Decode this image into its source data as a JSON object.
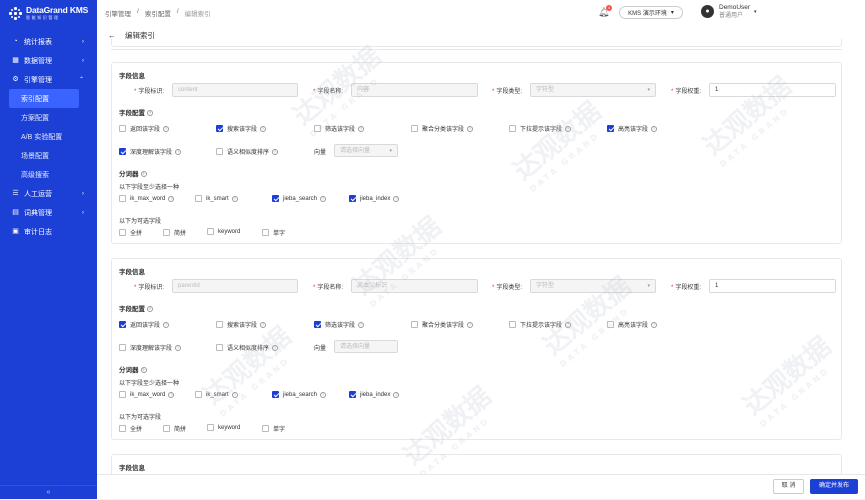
{
  "app": {
    "title": "DataGrand KMS",
    "subtitle": "智能知识管理"
  },
  "sidebar": {
    "items": [
      {
        "label": "统计报表",
        "icon": "chart-icon",
        "arrow": "›"
      },
      {
        "label": "数据管理",
        "icon": "database-icon",
        "arrow": "›"
      },
      {
        "label": "引擎管理",
        "icon": "engine-icon",
        "arrow": "⌃"
      },
      {
        "label": "人工运营",
        "icon": "operation-icon",
        "arrow": "›"
      },
      {
        "label": "词典管理",
        "icon": "dictionary-icon",
        "arrow": "›"
      },
      {
        "label": "审计日志",
        "icon": "audit-icon",
        "arrow": ""
      }
    ],
    "engine_sub": [
      "索引配置",
      "方案配置",
      "A/B 实验配置",
      "场景配置",
      "高级搜索"
    ],
    "collapse": "«"
  },
  "header": {
    "breadcrumb": [
      "引擎管理",
      "索引配置",
      "编辑索引"
    ],
    "separator": "/",
    "bell_count": "4",
    "env": "KMS 演示环境",
    "user_name": "DemoUser",
    "user_role": "普通用户"
  },
  "page": {
    "title": "编辑索引",
    "back": "←"
  },
  "labels": {
    "field_info": "字段信息",
    "field_id": "字段标识:",
    "field_name": "字段名称:",
    "field_type": "字段类型:",
    "field_weight": "字段权重:",
    "field_config": "字段配置",
    "recall": "返回该字段",
    "search": "搜索该字段",
    "filter": "筛选该字段",
    "aggregate": "聚合分类该字段",
    "dropdown": "下拉提示该字段",
    "highlight": "高亮该字段",
    "deep": "深度理解该字段",
    "semantic": "语义相似度排序",
    "vector": "向量",
    "vector_ph": "请选择向量",
    "tokenizer": "分词器",
    "at_least_one": "以下字段至少选择一种",
    "optional": "以下为可选字段",
    "ik_max_word": "ik_max_word",
    "ik_smart": "ik_smart",
    "jieba_search": "jieba_search",
    "jieba_index": "jieba_index",
    "pinyin_full": "全拼",
    "pinyin_short": "简拼",
    "keyword": "keyword",
    "single": "单字",
    "type_ph": "字符型",
    "info_q": "?"
  },
  "cards": [
    {
      "id_value": "content",
      "name_value": "内容",
      "weight": "1",
      "checks": {
        "recall": false,
        "search": true,
        "filter": false,
        "aggregate": false,
        "dropdown": false,
        "highlight": true,
        "deep": true,
        "semantic": false,
        "ik_max_word": false,
        "ik_smart": false,
        "jieba_search": true,
        "jieba_index": true,
        "pinyin_full": false,
        "pinyin_short": false,
        "keyword": false,
        "single": false
      }
    },
    {
      "id_value": "parentid",
      "name_value": "文本父标识",
      "weight": "1",
      "checks": {
        "recall": true,
        "search": false,
        "filter": true,
        "aggregate": false,
        "dropdown": false,
        "highlight": false,
        "deep": false,
        "semantic": false,
        "ik_max_word": false,
        "ik_smart": false,
        "jieba_search": true,
        "jieba_index": true,
        "pinyin_full": false,
        "pinyin_short": false,
        "keyword": false,
        "single": false
      }
    }
  ],
  "footer": {
    "cancel": "取 消",
    "confirm": "确定并发布"
  },
  "watermark": {
    "main": "达观数据",
    "sub": "DATA GRAND"
  },
  "colors": {
    "primary": "#1c3fd6",
    "active_sub": "#3a63ff"
  }
}
